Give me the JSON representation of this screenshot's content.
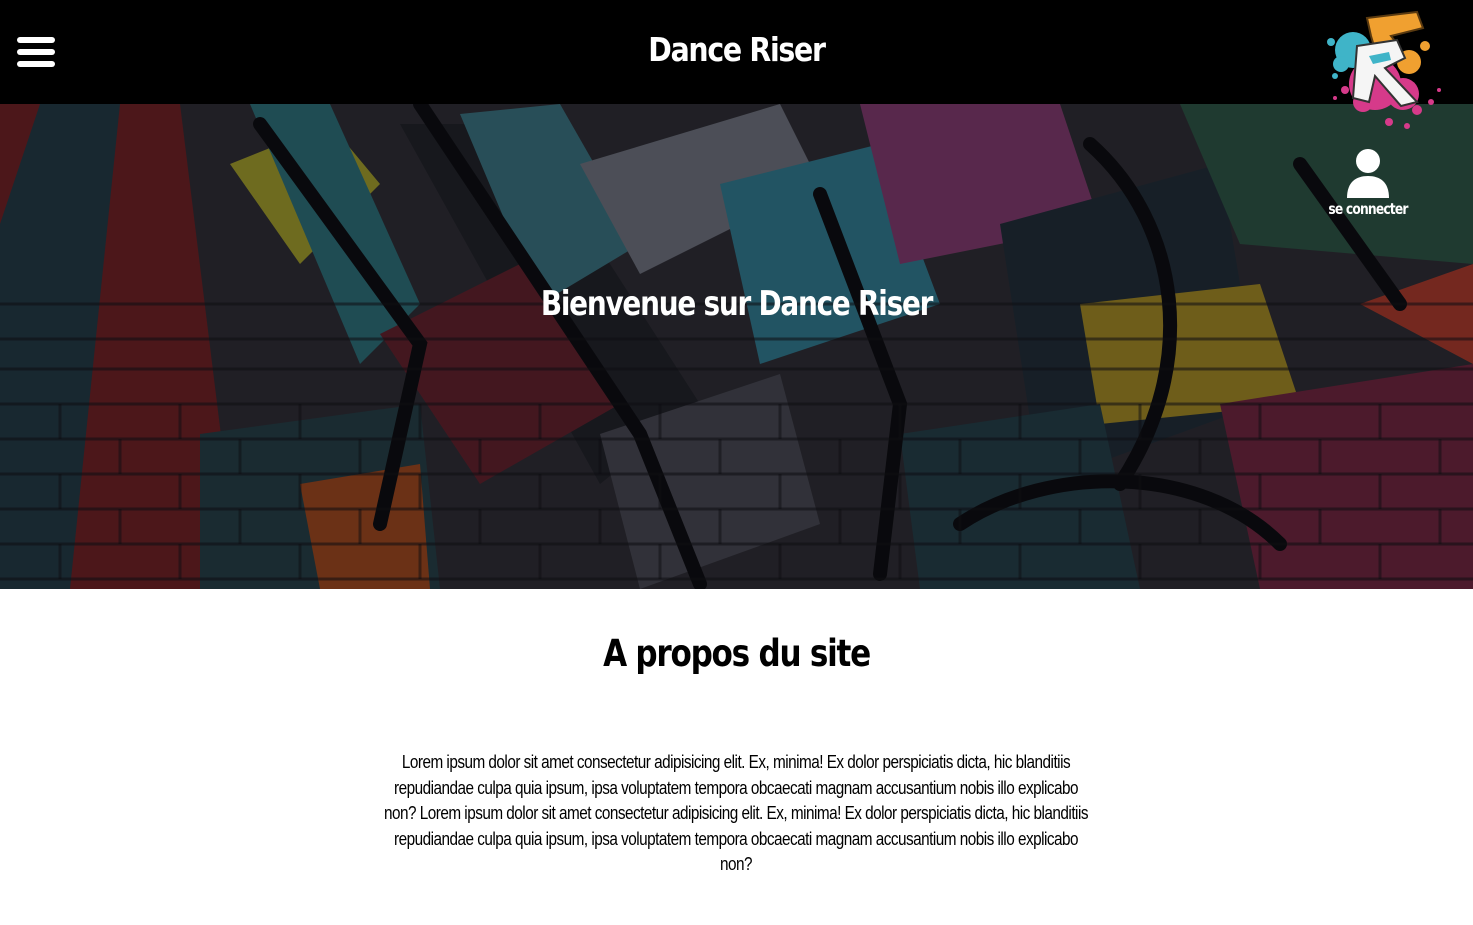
{
  "header": {
    "title": "Dance Riser",
    "menu_icon": "hamburger-icon",
    "logo": "dance-riser-logo"
  },
  "login": {
    "icon": "user-icon",
    "label": "se connecter"
  },
  "hero": {
    "title": "Bienvenue sur Dance Riser",
    "background": "graffiti-brick-wall"
  },
  "about": {
    "title": "A propos du site",
    "text": "Lorem ipsum dolor sit amet consectetur adipisicing elit. Ex, minima! Ex dolor perspiciatis dicta, hic blanditiis repudiandae culpa quia ipsum, ipsa voluptatem tempora obcaecati magnam accusantium nobis illo explicabo non? Lorem ipsum dolor sit amet consectetur adipisicing elit. Ex, minima! Ex dolor perspiciatis dicta, hic blanditiis repudiandae culpa quia ipsum, ipsa voluptatem tempora obcaecati magnam accusantium nobis illo explicabo non?"
  },
  "colors": {
    "header_bg": "#000000",
    "text_light": "#ffffff",
    "text_dark": "#000000",
    "logo_orange": "#f0a030",
    "logo_pink": "#d63a8a",
    "logo_cyan": "#3fb4c8"
  }
}
